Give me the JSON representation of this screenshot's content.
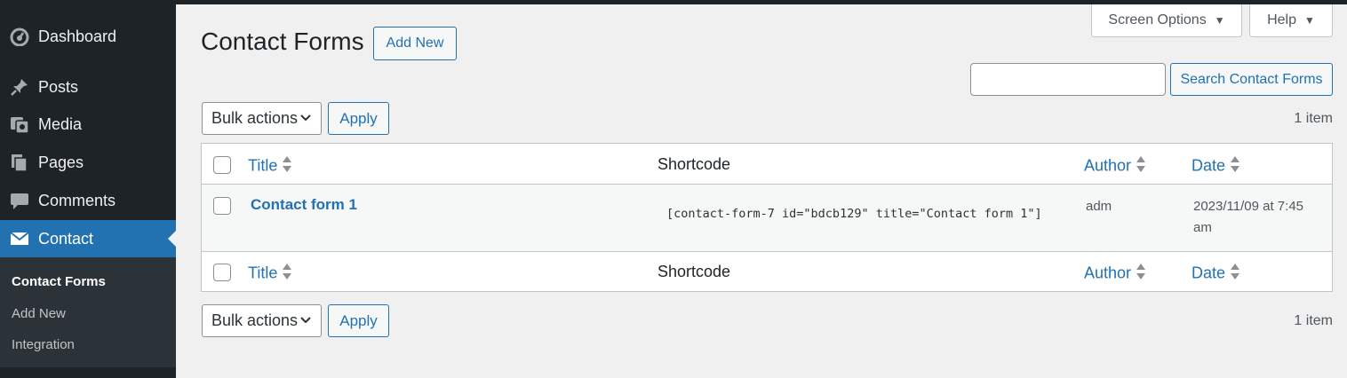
{
  "sidebar": {
    "items": [
      {
        "label": "Dashboard",
        "icon": "dashboard-icon"
      },
      {
        "label": "Posts",
        "icon": "pin-icon"
      },
      {
        "label": "Media",
        "icon": "media-icon"
      },
      {
        "label": "Pages",
        "icon": "pages-icon"
      },
      {
        "label": "Comments",
        "icon": "comment-icon"
      },
      {
        "label": "Contact",
        "icon": "envelope-icon",
        "active": true
      }
    ],
    "submenu": [
      {
        "label": "Contact Forms",
        "current": true
      },
      {
        "label": "Add New"
      },
      {
        "label": "Integration"
      }
    ]
  },
  "header_tabs": {
    "screen_options": "Screen Options",
    "help": "Help"
  },
  "page": {
    "title": "Contact Forms",
    "add_new": "Add New"
  },
  "search": {
    "value": "",
    "button": "Search Contact Forms"
  },
  "bulk": {
    "select_label": "Bulk actions",
    "apply": "Apply",
    "count": "1 item"
  },
  "table": {
    "columns": {
      "title": "Title",
      "shortcode": "Shortcode",
      "author": "Author",
      "date": "Date"
    },
    "rows": [
      {
        "title": "Contact form 1",
        "shortcode": "[contact-form-7 id=\"bdcb129\" title=\"Contact form 1\"]",
        "author": "adm",
        "date_line1": "2023/11/09 at 7:45",
        "date_line2": "am"
      }
    ]
  },
  "colors": {
    "sidebar_bg": "#1d2327",
    "accent": "#2271b1",
    "page_bg": "#f0f0f1"
  }
}
